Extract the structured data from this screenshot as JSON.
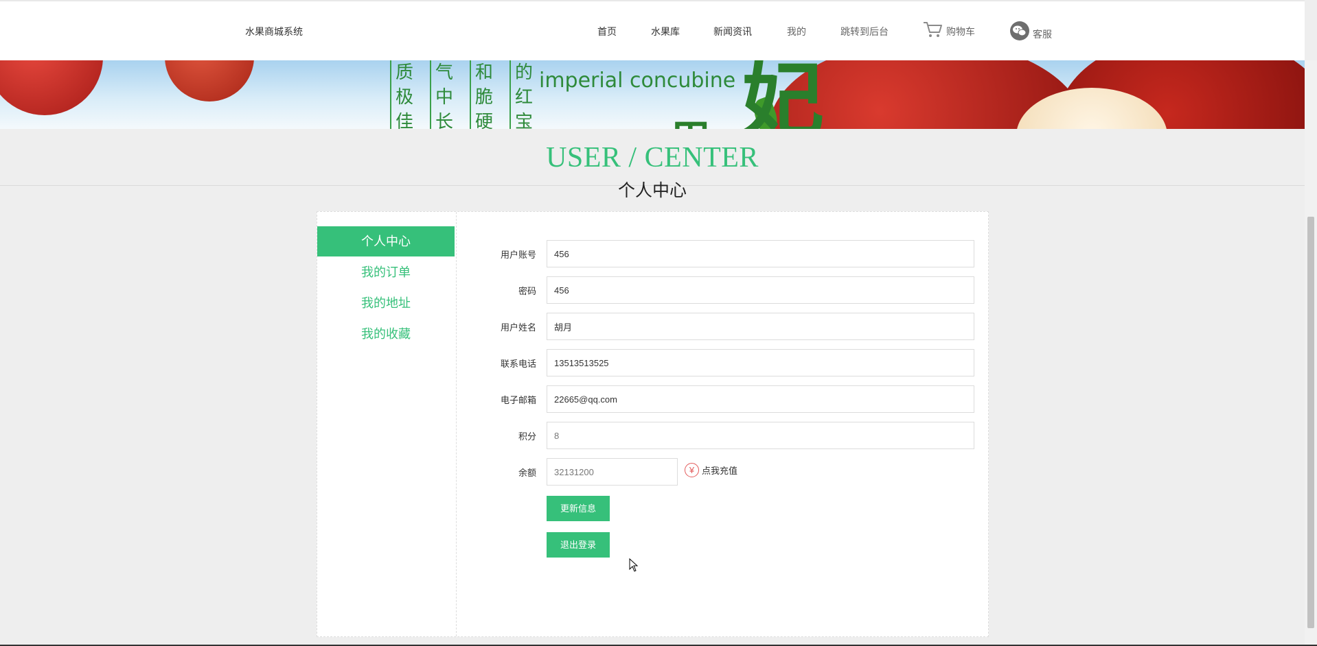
{
  "header": {
    "site_title": "水果商城系统",
    "nav": {
      "home": "首页",
      "fruit_library": "水果库",
      "news": "新闻资讯",
      "mine": "我的",
      "admin": "跳转到后台",
      "cart": "购物车",
      "service": "客服"
    }
  },
  "banner": {
    "poem_columns": [
      "质极佳",
      "气中长",
      "和脆硬",
      "的红宝"
    ],
    "english_text": "imperial concubine",
    "brand_glyph": "妃",
    "small_glyph": "用"
  },
  "page_heading": {
    "english": "USER / CENTER",
    "chinese": "个人中心"
  },
  "sidebar": {
    "items": [
      {
        "label": "个人中心",
        "active": true
      },
      {
        "label": "我的订单",
        "active": false
      },
      {
        "label": "我的地址",
        "active": false
      },
      {
        "label": "我的收藏",
        "active": false
      }
    ]
  },
  "form": {
    "account": {
      "label": "用户账号",
      "value": "456"
    },
    "password": {
      "label": "密码",
      "value": "456"
    },
    "name": {
      "label": "用户姓名",
      "value": "胡月"
    },
    "phone": {
      "label": "联系电话",
      "value": "13513513525"
    },
    "email": {
      "label": "电子邮箱",
      "value": "22665@qq.com"
    },
    "points": {
      "label": "积分",
      "value": "8"
    },
    "balance": {
      "label": "余额",
      "value": "32131200"
    },
    "recharge_symbol": "¥",
    "recharge_label": "点我充值",
    "update_button": "更新信息",
    "logout_button": "退出登录"
  },
  "colors": {
    "accent": "#36c07a",
    "page_background": "#eeeeee",
    "recharge_icon": "#e35b5b"
  }
}
